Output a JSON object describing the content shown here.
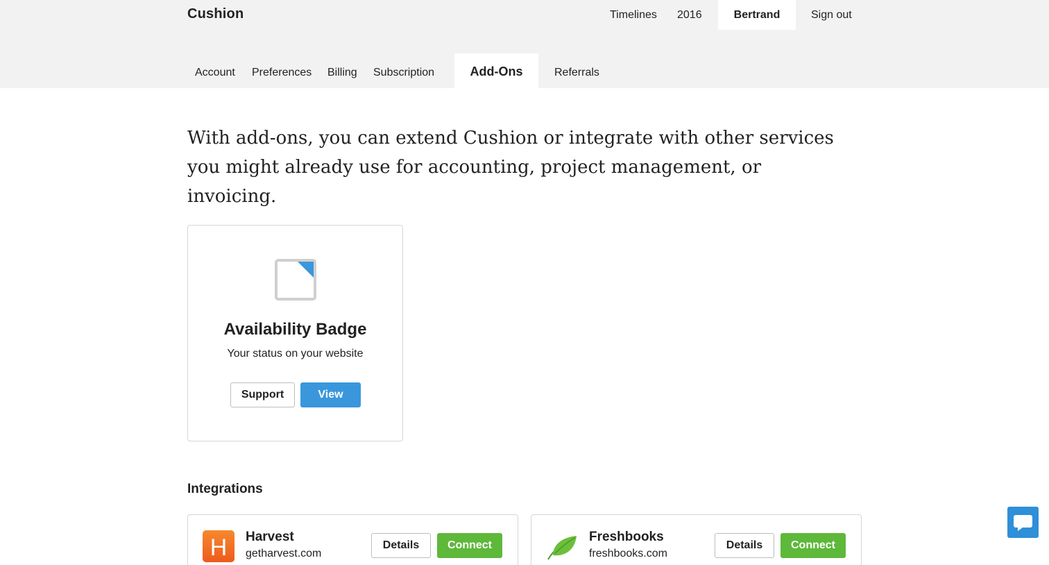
{
  "app": {
    "brand": "Cushion"
  },
  "topnav": {
    "timelines": "Timelines",
    "year": "2016",
    "user": "Bertrand",
    "signout": "Sign out"
  },
  "tabs": [
    "Account",
    "Preferences",
    "Billing",
    "Subscription",
    "Add-Ons",
    "Referrals"
  ],
  "active_tab": "Add-Ons",
  "intro": "With add-ons, you can extend Cushion or integrate with other services you might already use for accounting, project management, or invoicing.",
  "addon": {
    "title": "Availability Badge",
    "subtitle": "Your status on your website",
    "support_label": "Support",
    "view_label": "View"
  },
  "integrations": {
    "title": "Integrations",
    "items": [
      {
        "name": "Harvest",
        "domain": "getharvest.com",
        "logo_letter": "H",
        "details_label": "Details",
        "connect_label": "Connect",
        "icon": "harvest-logo-icon"
      },
      {
        "name": "Freshbooks",
        "domain": "freshbooks.com",
        "details_label": "Details",
        "connect_label": "Connect",
        "icon": "freshbooks-leaf-icon"
      }
    ]
  },
  "colors": {
    "header_bg": "#f2f2f2",
    "blue": "#3a97dc",
    "green": "#5eb83a",
    "harvest_orange": "#f36c21",
    "chat_blue": "#2f8fd8"
  }
}
